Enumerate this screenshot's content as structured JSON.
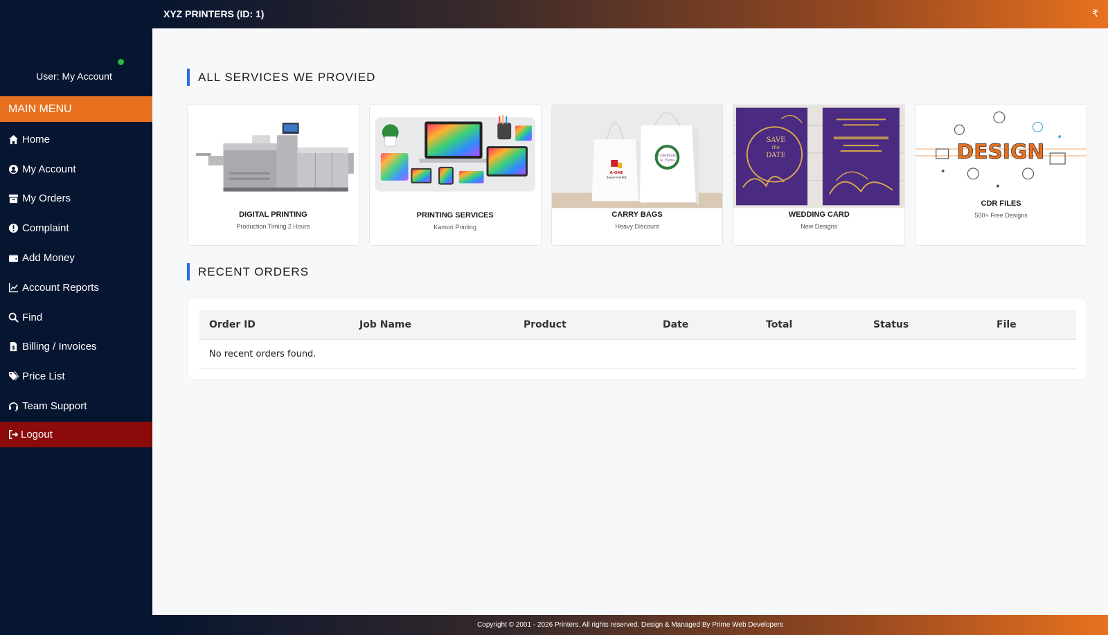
{
  "header": {
    "title": "XYZ PRINTERS (ID: 1)",
    "currency_symbol": "₹"
  },
  "sidebar": {
    "user_label": "User: My Account",
    "main_menu_label": "MAIN MENU",
    "items": [
      {
        "label": "Home",
        "icon": "home-icon"
      },
      {
        "label": "My Account",
        "icon": "user-circle-icon"
      },
      {
        "label": "My Orders",
        "icon": "box-icon"
      },
      {
        "label": "Complaint",
        "icon": "exclamation-circle-icon"
      },
      {
        "label": "Add Money",
        "icon": "wallet-icon"
      },
      {
        "label": "Account Reports",
        "icon": "line-chart-icon"
      },
      {
        "label": "Find",
        "icon": "search-icon"
      },
      {
        "label": "Billing / Invoices",
        "icon": "invoice-icon"
      },
      {
        "label": "Price List",
        "icon": "tags-icon"
      },
      {
        "label": "Team Support",
        "icon": "headset-icon"
      }
    ],
    "logout_label": "Logout"
  },
  "services": {
    "heading": "ALL SERVICES WE PROVIED",
    "cards": [
      {
        "title": "DIGITAL PRINTING",
        "subtitle": "Production Timing 2 Hours"
      },
      {
        "title": "PRINTING SERVICES",
        "subtitle": "Kamori Printing"
      },
      {
        "title": "CARRY BAGS",
        "subtitle": "Heavy Discount"
      },
      {
        "title": "WEDDING CARD",
        "subtitle": "New Designs"
      },
      {
        "title": "CDR FILES",
        "subtitle": "500+ Free Designs"
      }
    ],
    "image_text": {
      "bag_brand": "A-ONE",
      "bag_sub": "Supermarket",
      "bag_badge_line1": "Celebrate",
      "bag_badge_line2": "& Flora",
      "save_the_date_1": "SAVE",
      "save_the_date_2": "the",
      "save_the_date_3": "DATE",
      "design_word": "DESIGN"
    }
  },
  "orders": {
    "heading": "RECENT ORDERS",
    "columns": [
      "Order ID",
      "Job Name",
      "Product",
      "Date",
      "Total",
      "Status",
      "File"
    ],
    "empty_message": "No recent orders found."
  },
  "footer": {
    "text": "Copyright © 2001 - 2026 Printers. All rights reserved. Design & Managed By Prime Web Developers"
  },
  "colors": {
    "sidebar_bg": "#061530",
    "accent_orange": "#e8711f",
    "logout_red": "#8b0a0a",
    "heading_bar": "#2a6ee6",
    "online": "#28b83f"
  }
}
